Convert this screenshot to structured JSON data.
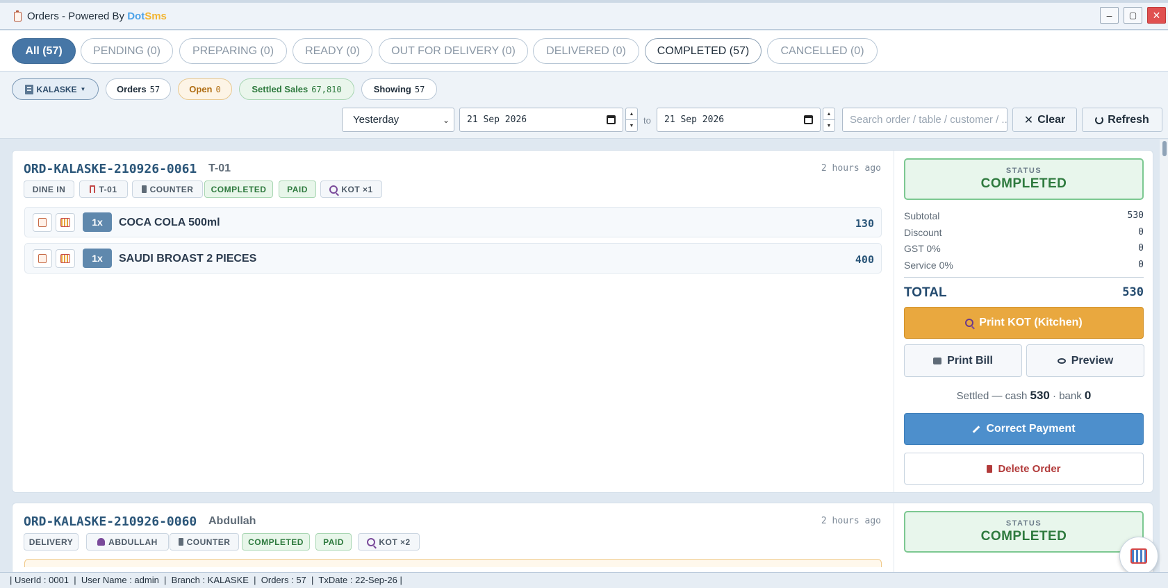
{
  "window": {
    "title_prefix": "Orders - Powered By ",
    "brand_a": "Dot",
    "brand_b": "Sms",
    "minimize": "–",
    "maximize": "▢",
    "close": "✕"
  },
  "tabs": [
    {
      "label": "All (57)"
    },
    {
      "label": "PENDING (0)"
    },
    {
      "label": "PREPARING (0)"
    },
    {
      "label": "READY (0)"
    },
    {
      "label": "OUT FOR DELIVERY (0)"
    },
    {
      "label": "DELIVERED (0)"
    },
    {
      "label": "COMPLETED (57)"
    },
    {
      "label": "CANCELLED (0)"
    }
  ],
  "filters": {
    "branch": "KALASKE",
    "orders_label": "Orders",
    "orders_value": "57",
    "open_label": "Open",
    "open_value": "0",
    "settled_label": "Settled Sales",
    "settled_value": "67,810",
    "showing_label": "Showing",
    "showing_value": "57",
    "period": "Yesterday",
    "date_from": "21 Sep 2026",
    "to_label": "to",
    "date_to": "21 Sep 2026",
    "search_placeholder": "Search order / table / customer / ...",
    "clear_label": "Clear",
    "refresh_label": "Refresh"
  },
  "orders": [
    {
      "id": "ORD-KALASKE-210926-0061",
      "ref": "T-01",
      "ago": "2 hours ago",
      "tags": [
        "DINE IN",
        "T-01",
        "COUNTER",
        "COMPLETED",
        "PAID",
        "KOT ×1"
      ],
      "items": [
        {
          "qty": "1x",
          "name": "COCA COLA 500ml",
          "price": "130"
        },
        {
          "qty": "1x",
          "name": "SAUDI BROAST 2 PIECES",
          "price": "400"
        }
      ],
      "status_label": "STATUS",
      "status": "COMPLETED",
      "subtotal_label": "Subtotal",
      "subtotal": "530",
      "discount_label": "Discount",
      "discount": "0",
      "gst_label": "GST 0%",
      "gst": "0",
      "service_label": "Service 0%",
      "service": "0",
      "total_label": "TOTAL",
      "total": "530",
      "print_kot": "Print KOT (Kitchen)",
      "print_bill": "Print Bill",
      "preview": "Preview",
      "settled_text": "Settled — cash",
      "cash": "530",
      "bank_text": "· bank",
      "bank": "0",
      "correct_payment": "Correct Payment",
      "delete_order": "Delete Order"
    },
    {
      "id": "ORD-KALASKE-210926-0060",
      "ref": "Abdullah",
      "ago": "2 hours ago",
      "tags": [
        "DELIVERY",
        "ABDULLAH",
        "COUNTER",
        "COMPLETED",
        "PAID",
        "KOT ×2"
      ],
      "status_label": "STATUS",
      "status": "COMPLETED"
    }
  ],
  "statusbar": "| UserId : 0001  |  User Name : admin  |  Branch : KALASKE  |  Orders : 57  |  TxDate : 22-Sep-26 |",
  "colors": {
    "accent": "#4676a6",
    "completed": "#2e7a3e",
    "kot_button": "#e9a83f",
    "correct_payment": "#4d8fcc",
    "delete": "#b23a3a"
  }
}
